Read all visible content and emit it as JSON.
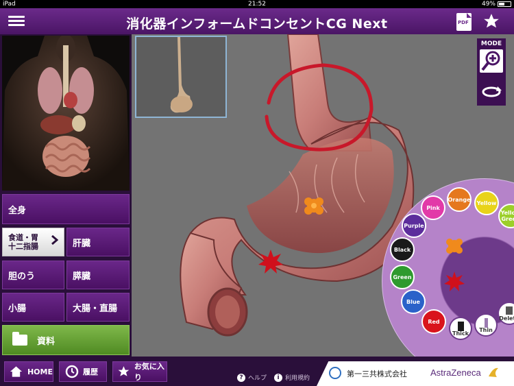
{
  "status_bar": {
    "device": "iPad",
    "time": "21:52",
    "battery": "49%",
    "battery_level": 0.49
  },
  "header": {
    "title": "消化器インフォームドコンセントCG  Next",
    "menu_icon": "hamburger-icon",
    "pdf_icon": "pdf-icon",
    "pdf_text": "PDF",
    "favorite_icon": "star-icon"
  },
  "sidebar": {
    "items": [
      {
        "label": "全身"
      },
      {
        "label_line1": "食道・胃",
        "label_line2": "十二指腸",
        "selected": true
      },
      {
        "label": "肝臓"
      },
      {
        "label": "胆のう"
      },
      {
        "label": "膵臓"
      },
      {
        "label": "小腸"
      },
      {
        "label": "大腸・直腸"
      }
    ],
    "documents": {
      "label": "資料",
      "icon": "folder-icon"
    }
  },
  "viewer": {
    "mode_label": "MODE",
    "zoom_icon": "zoom-in-icon",
    "rotate_icon": "rotate-icon"
  },
  "palette": {
    "colors": [
      {
        "label": "Orange",
        "color": "#e5781e"
      },
      {
        "label": "Yellow",
        "color": "#e8d31a"
      },
      {
        "label": "Yellow Green",
        "color": "#9ccf2a"
      },
      {
        "label": "Pink",
        "color": "#e23aa8"
      },
      {
        "label": "Purple",
        "color": "#5c2d9c"
      },
      {
        "label": "Black",
        "color": "#1a1a1a"
      },
      {
        "label": "Green",
        "color": "#2e9a2e"
      },
      {
        "label": "Blue",
        "color": "#2a62c9"
      },
      {
        "label": "Red",
        "color": "#d9141c"
      }
    ],
    "thick_label": "Thick",
    "thin_label": "Thin",
    "delete_label": "Delete",
    "accent": "#6d3a8a"
  },
  "footer": {
    "home_label": "HOME",
    "history_label": "履歴",
    "favorites_label": "お気に入り",
    "help_label": "ヘルプ",
    "terms_label": "利用規約",
    "sponsor1": "第一三共株式会社",
    "sponsor2": "AstraZeneca"
  }
}
